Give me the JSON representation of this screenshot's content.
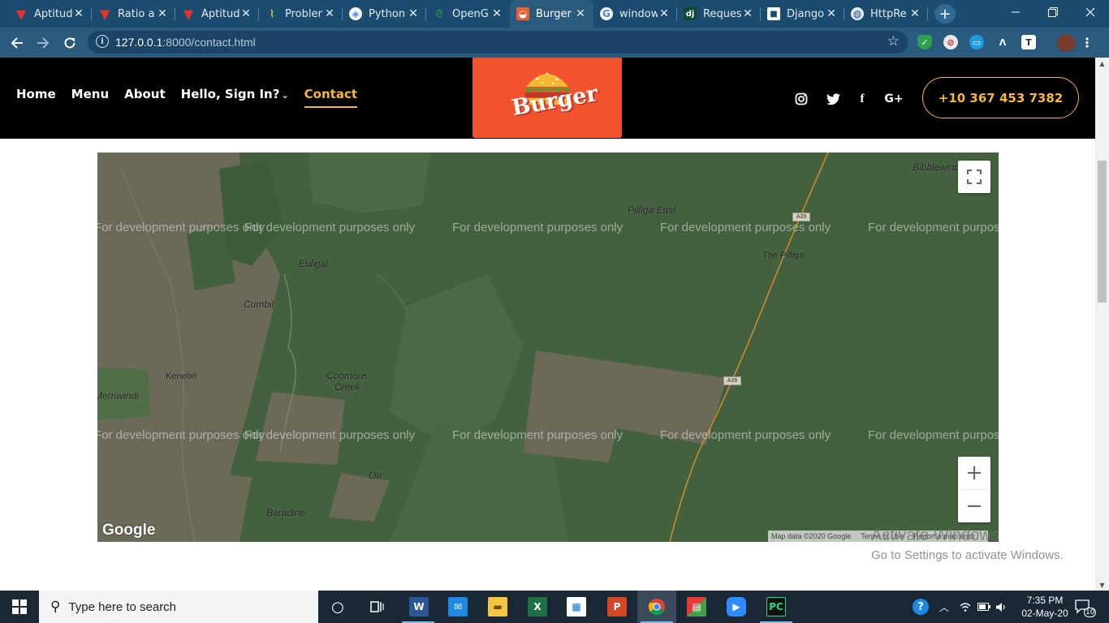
{
  "browser": {
    "tabs": [
      {
        "title": "Aptitud",
        "icon": "v-logo-icon"
      },
      {
        "title": "Ratio a",
        "icon": "v-logo-icon"
      },
      {
        "title": "Aptitud",
        "icon": "v-logo-icon"
      },
      {
        "title": "Probler",
        "icon": "python-snake-icon"
      },
      {
        "title": "Python",
        "icon": "colab-icon"
      },
      {
        "title": "OpenG",
        "icon": "gfg-icon"
      },
      {
        "title": "Burger",
        "icon": "burger-favicon"
      },
      {
        "title": "window",
        "icon": "google-icon"
      },
      {
        "title": "Reques",
        "icon": "django-icon"
      },
      {
        "title": "Django",
        "icon": "square-icon"
      },
      {
        "title": "HttpRe",
        "icon": "globe-icon"
      }
    ],
    "active_tab_index": 6,
    "close_glyph": "✕",
    "new_tab_glyph": "+",
    "url_host": "127.0.0.1",
    "url_path": ":8000/contact.html"
  },
  "site": {
    "menu": [
      {
        "label": "Home"
      },
      {
        "label": "Menu"
      },
      {
        "label": "About"
      },
      {
        "label": "Hello, Sign In?",
        "dropdown": true
      },
      {
        "label": "Contact",
        "active": true
      }
    ],
    "logo_text": "Burger",
    "social": [
      "instagram-icon",
      "twitter-icon",
      "facebook-icon",
      "google-plus-icon"
    ],
    "social_glyphs": {
      "facebook": "f",
      "google_plus": "G+"
    },
    "phone": "+10 367 453 7382",
    "accent_color": "#f7b731",
    "logo_bg": "#f0532b"
  },
  "map": {
    "watermark": "For development purposes only",
    "places": {
      "pilliga_east": "Pilliga East",
      "the_pilliga": "The Pilliga",
      "euligal": "Euligal",
      "cumbil": "Cumbil",
      "kenebri": "Kenebri",
      "merriwindi": "Merriwindi",
      "coomore_creek_1": "Coomore",
      "coomore_creek_2": "Creek",
      "orr": "Orr",
      "baradine": "Baradine",
      "bibblewindi": "Bibblewindi"
    },
    "road_label": "A39",
    "google_logo": "Google",
    "attribution": {
      "map_data": "Map data ©2020 Google",
      "terms": "Terms of Use",
      "report": "Report a map error"
    },
    "zoom_in": "+",
    "zoom_out": "−"
  },
  "windows_activation": {
    "line1": "Activate Windows",
    "line2": "Go to Settings to activate Windows."
  },
  "taskbar": {
    "search_placeholder": "Type here to search",
    "time": "7:35 PM",
    "date": "02-May-20",
    "notification_count": "10"
  }
}
